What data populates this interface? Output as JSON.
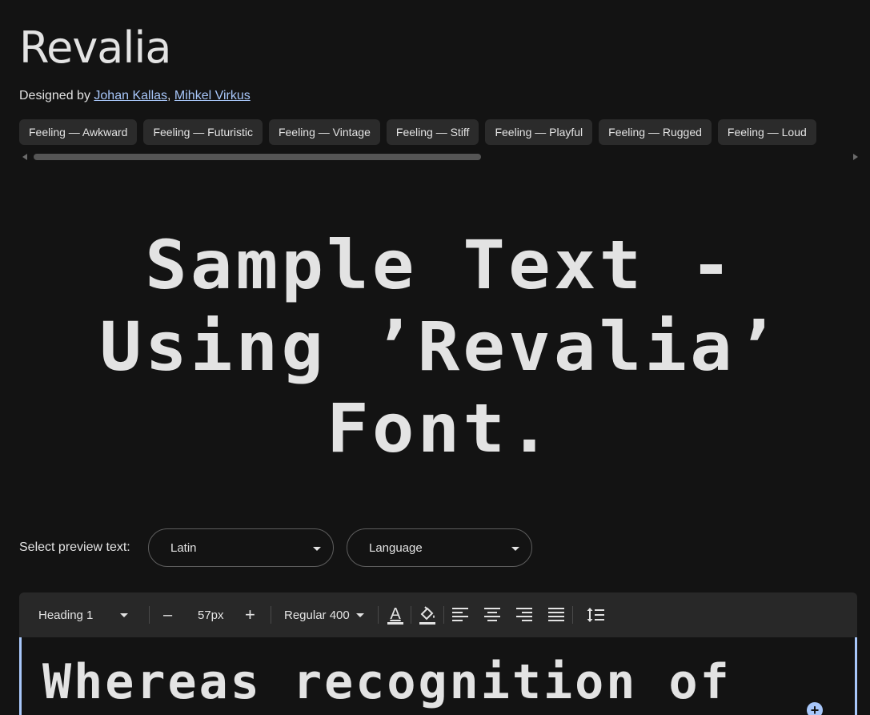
{
  "font": {
    "name": "Revalia",
    "designed_by_label": "Designed by",
    "designers": [
      "Johan Kallas",
      "Mihkel Virkus"
    ]
  },
  "tags": [
    "Feeling — Awkward",
    "Feeling — Futuristic",
    "Feeling — Vintage",
    "Feeling — Stiff",
    "Feeling — Playful",
    "Feeling — Rugged",
    "Feeling — Loud"
  ],
  "sample": {
    "lines": [
      "Sample Text -",
      "Using ’Revalia’",
      "Font."
    ]
  },
  "preview": {
    "label": "Select preview text:",
    "script_select": "Latin",
    "language_select": "Language"
  },
  "toolbar": {
    "style_select": "Heading 1",
    "decrease_label": "–",
    "font_size": "57px",
    "increase_label": "+",
    "weight_select": "Regular 400",
    "icons": [
      "text-color-icon",
      "highlight-color-icon",
      "align-left-icon",
      "align-center-icon",
      "align-right-icon",
      "align-justify-icon",
      "line-height-icon"
    ]
  },
  "editor": {
    "text": "Whereas recognition of"
  },
  "colors": {
    "background": "#131313",
    "toolbar": "#282828",
    "chip": "#2b2b2b",
    "link": "#a8c7fa",
    "text": "#e3e3e3",
    "highlight_underline": "#a8c7fa"
  }
}
